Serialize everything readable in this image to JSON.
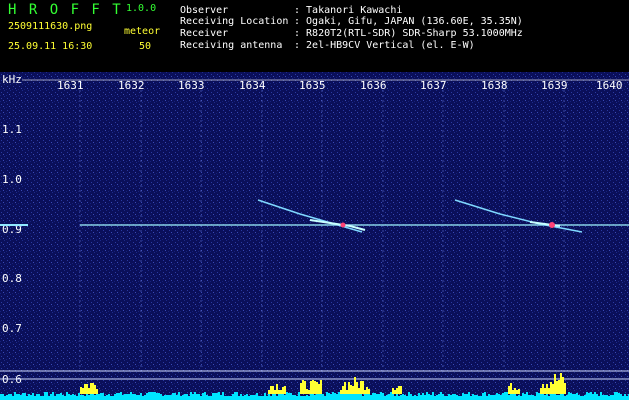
{
  "app": {
    "title": "H R O F F T",
    "version": "1.0.0",
    "filename": "2509111630.png",
    "datetime": "25.09.11 16:30",
    "meteor_label": "meteor",
    "meteor_count": "50"
  },
  "info": {
    "observer_label": "Observer",
    "observer_value": ": Takanori Kawachi",
    "location_label": "Receiving Location",
    "location_value": ": Ogaki, Gifu, JAPAN (136.60E, 35.35N)",
    "receiver_label": "Receiver",
    "receiver_value": ": R820T2(RTL-SDR) SDR-Sharp 53.1000MHz",
    "antenna_label": "Receiving antenna",
    "antenna_value": ": 2el-HB9CV Vertical (el. E-W)"
  },
  "spectrogram": {
    "y_unit": "kHz",
    "y_ticks": [
      "1.1",
      "1.0",
      "0.9",
      "0.8",
      "0.7",
      "0.6"
    ],
    "x_ticks": [
      "1631",
      "1632",
      "1633",
      "1634",
      "1635",
      "1636",
      "1637",
      "1638",
      "1639",
      "1640"
    ],
    "colors": {
      "background": "#0a0f5a",
      "noise": "#2a3aa0",
      "carrier": "#9ff2ff",
      "grid": "#ffffff",
      "bars_cyan": "#00e5ff",
      "bars_yellow": "#ffff33"
    }
  }
}
